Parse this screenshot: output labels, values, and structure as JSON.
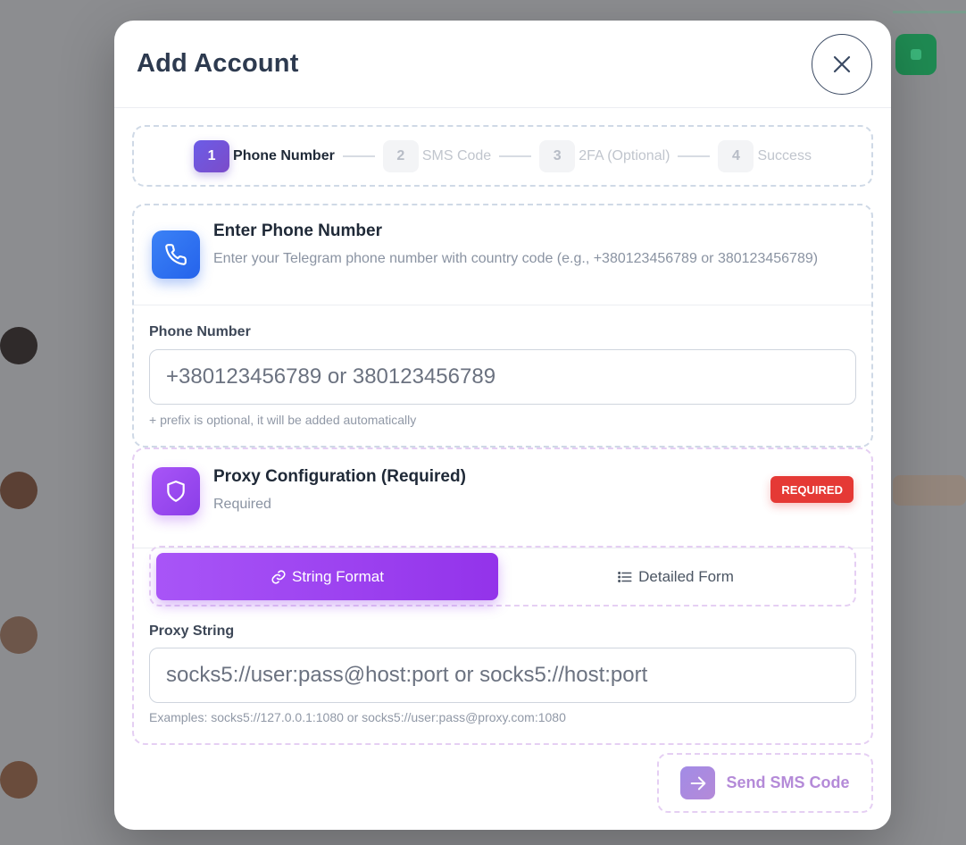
{
  "modal": {
    "title": "Add Account",
    "close_icon": "close-icon"
  },
  "stepper": {
    "steps": [
      {
        "num": "1",
        "label": "Phone Number",
        "active": true
      },
      {
        "num": "2",
        "label": "SMS Code",
        "active": false
      },
      {
        "num": "3",
        "label": "2FA (Optional)",
        "active": false
      },
      {
        "num": "4",
        "label": "Success",
        "active": false
      }
    ]
  },
  "phone_section": {
    "icon": "phone-icon",
    "title": "Enter Phone Number",
    "description": "Enter your Telegram phone number with country code (e.g., +380123456789 or 380123456789)",
    "field_label": "Phone Number",
    "placeholder": "+380123456789 or 380123456789",
    "value": "",
    "hint": "+ prefix is optional, it will be added automatically"
  },
  "proxy_section": {
    "icon": "shield-icon",
    "title": "Proxy Configuration (Required)",
    "subtitle": "Required",
    "badge": "REQUIRED",
    "tabs": [
      {
        "label": "String Format",
        "icon": "link-icon",
        "active": true
      },
      {
        "label": "Detailed Form",
        "icon": "list-icon",
        "active": false
      }
    ],
    "field_label": "Proxy String",
    "placeholder": "socks5://user:pass@host:port or socks5://host:port",
    "value": "",
    "examples": "Examples: socks5://127.0.0.1:1080 or socks5://user:pass@proxy.com:1080"
  },
  "footer": {
    "send_label": "Send SMS Code",
    "send_icon": "arrow-right-icon"
  },
  "colors": {
    "primary_purple": "#9333ea",
    "step_active": "#6c5ce7",
    "phone_icon_bg": "#2563eb",
    "badge_red": "#e53935",
    "send_disabled": "#b48ad8"
  }
}
